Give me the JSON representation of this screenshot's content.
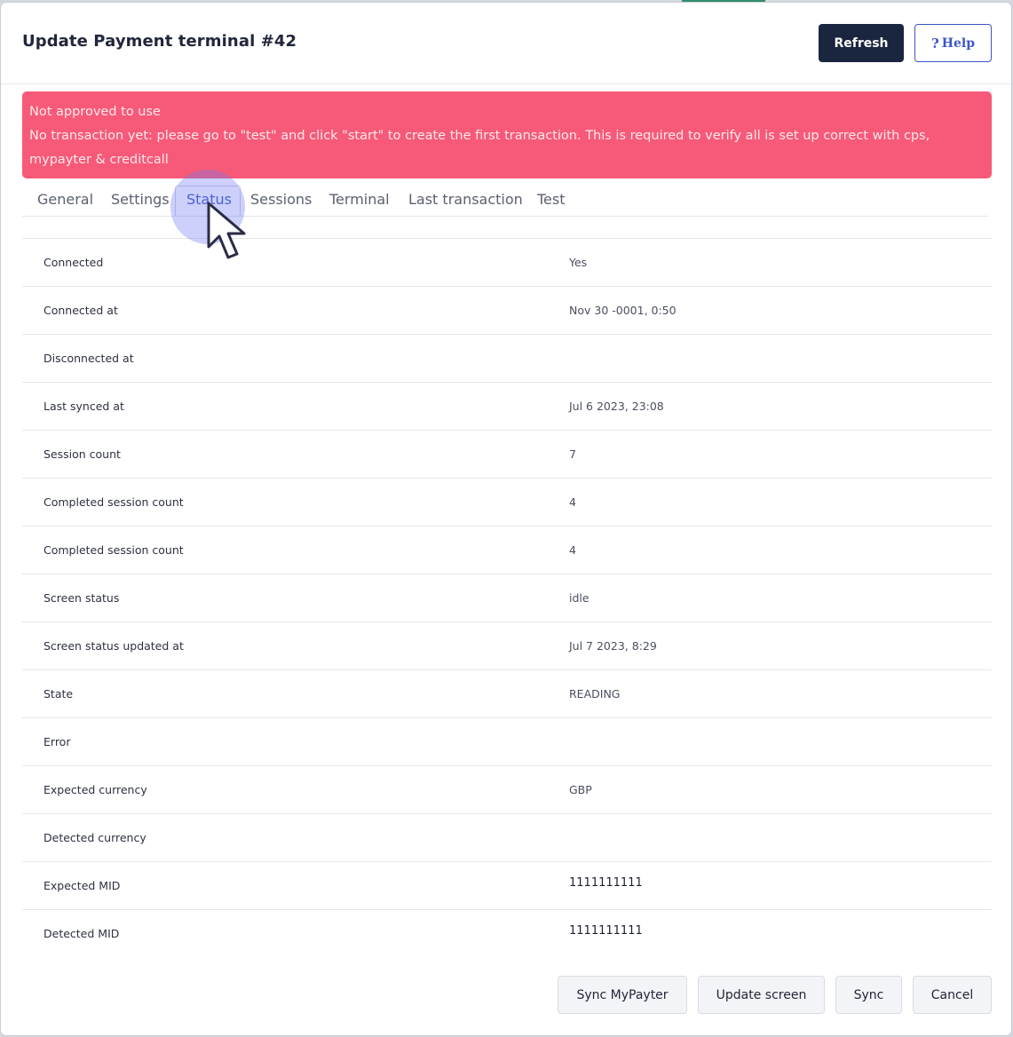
{
  "dialog": {
    "title": "Update Payment terminal #42",
    "refresh_label": "Refresh",
    "help_label": "Help",
    "help_icon": "question-mark-icon"
  },
  "alert": {
    "line1": "Not approved to use",
    "line2": "No transaction yet: please go to \"test\" and click \"start\" to create the first transaction. This is required to verify all is set up correct with cps, mypayter & creditcall"
  },
  "tabs": [
    {
      "label": "General"
    },
    {
      "label": "Settings"
    },
    {
      "label": "Status",
      "active": true
    },
    {
      "label": "Sessions"
    },
    {
      "label": "Terminal"
    },
    {
      "label": "Last transaction"
    },
    {
      "label": "Test"
    }
  ],
  "status_rows": [
    {
      "label": "Connected",
      "value": "Yes"
    },
    {
      "label": "Connected at",
      "value": "Nov 30 -0001, 0:50"
    },
    {
      "label": "Disconnected at",
      "value": ""
    },
    {
      "label": "Last synced at",
      "value": "Jul 6 2023, 23:08"
    },
    {
      "label": "Session count",
      "value": "7"
    },
    {
      "label": "Completed session count",
      "value": "4"
    },
    {
      "label": "Completed session count",
      "value": "4"
    },
    {
      "label": "Screen status",
      "value": "idle"
    },
    {
      "label": "Screen status updated at",
      "value": "Jul 7 2023, 8:29"
    },
    {
      "label": "State",
      "value": "READING"
    },
    {
      "label": "Error",
      "value": ""
    },
    {
      "label": "Expected currency",
      "value": "GBP"
    },
    {
      "label": "Detected currency",
      "value": ""
    },
    {
      "label": "Expected MID",
      "value": "1111111111"
    },
    {
      "label": "Detected MID",
      "value": "1111111111"
    }
  ],
  "footer": {
    "sync_mypayter_label": "Sync MyPayter",
    "update_screen_label": "Update screen",
    "sync_label": "Sync",
    "cancel_label": "Cancel"
  },
  "colors": {
    "primary": "#1a2540",
    "accent": "#3b55c8",
    "alert_bg": "#f75a78"
  }
}
